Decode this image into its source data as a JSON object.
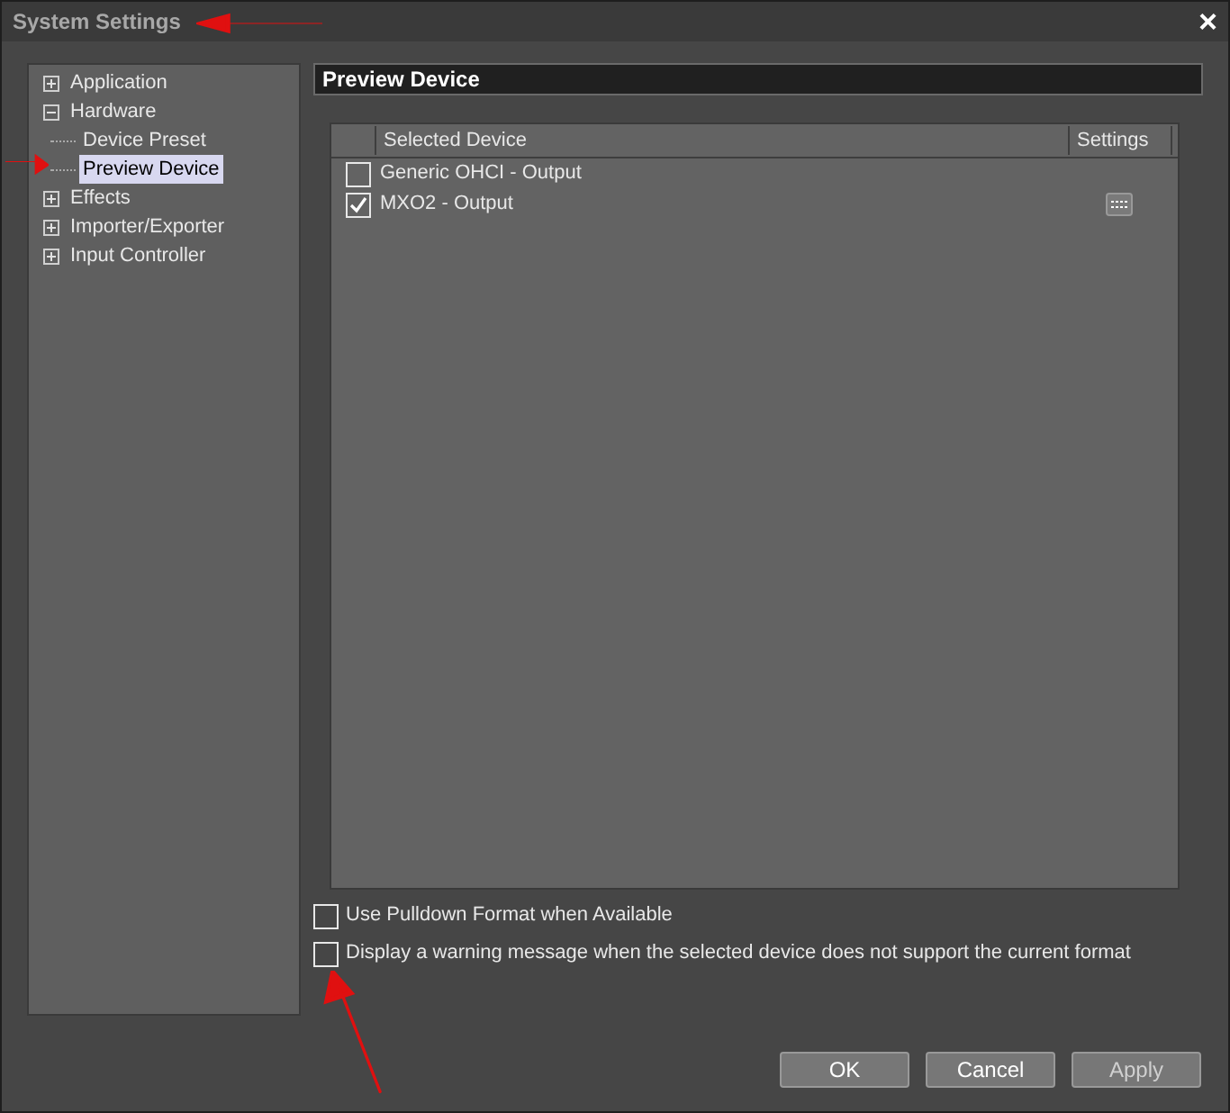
{
  "window": {
    "title": "System Settings",
    "close": "×"
  },
  "tree": [
    {
      "label": "Application",
      "expanded": false,
      "selected": false
    },
    {
      "label": "Hardware",
      "expanded": true,
      "selected": false,
      "children": [
        {
          "label": "Device Preset",
          "selected": false
        },
        {
          "label": "Preview Device",
          "selected": true
        }
      ]
    },
    {
      "label": "Effects",
      "expanded": false,
      "selected": false
    },
    {
      "label": "Importer/Exporter",
      "expanded": false,
      "selected": false
    },
    {
      "label": "Input Controller",
      "expanded": false,
      "selected": false
    }
  ],
  "panel": {
    "title": "Preview Device"
  },
  "table": {
    "columns": [
      "Selected Device",
      "Settings"
    ],
    "rows": [
      {
        "name": "Generic OHCI - Output",
        "checked": false,
        "has_settings": false
      },
      {
        "name": "MXO2 - Output",
        "checked": true,
        "has_settings": true
      }
    ]
  },
  "options": [
    {
      "label": "Use Pulldown Format when Available",
      "checked": false
    },
    {
      "label": "Display a warning message when the selected device does not support the current format",
      "checked": false
    }
  ],
  "buttons": [
    {
      "label": "OK",
      "disabled": false
    },
    {
      "label": "Cancel",
      "disabled": false
    },
    {
      "label": "Apply",
      "disabled": true
    }
  ]
}
